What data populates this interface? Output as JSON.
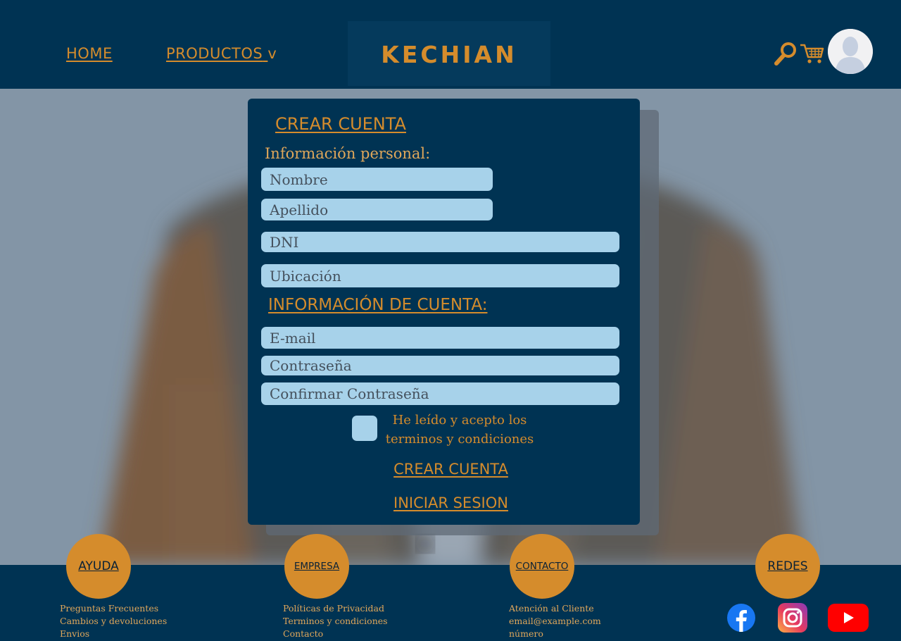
{
  "nav": {
    "home": "HOME",
    "products": "PRODUCTOS",
    "products_arrow": "v"
  },
  "logo": "KECHIAN",
  "form": {
    "title": "CREAR CUENTA",
    "personal_label": "Información personal:",
    "fields_personal": [
      "Nombre",
      "Apellido",
      "DNI",
      "Ubicación"
    ],
    "account_title": "INFORMACIÓN DE CUENTA:",
    "fields_account": [
      "E-mail",
      "Contraseña",
      "Confirmar Contraseña"
    ],
    "terms_line1": "He leído y acepto los",
    "terms_line2": "terminos y condiciones",
    "create_button": "CREAR CUENTA",
    "login_link": "INICIAR SESION"
  },
  "footer": {
    "ayuda": {
      "title": "AYUDA",
      "links": [
        "Preguntas Frecuentes",
        "Cambios y devoluciones",
        "Envios"
      ]
    },
    "empresa": {
      "title": "EMPRESA",
      "links": [
        "Políticas de Privacidad",
        "Terminos y condiciones",
        "Contacto"
      ]
    },
    "contacto": {
      "title": "CONTACTO",
      "links": [
        "Atención al Cliente",
        "email@example.com",
        "número"
      ]
    },
    "redes": {
      "title": "REDES",
      "icons": [
        "facebook-icon",
        "instagram-icon",
        "youtube-icon"
      ]
    }
  },
  "colors": {
    "navy": "#003353",
    "accent": "#d58c2c",
    "field": "#a7d2ea"
  }
}
